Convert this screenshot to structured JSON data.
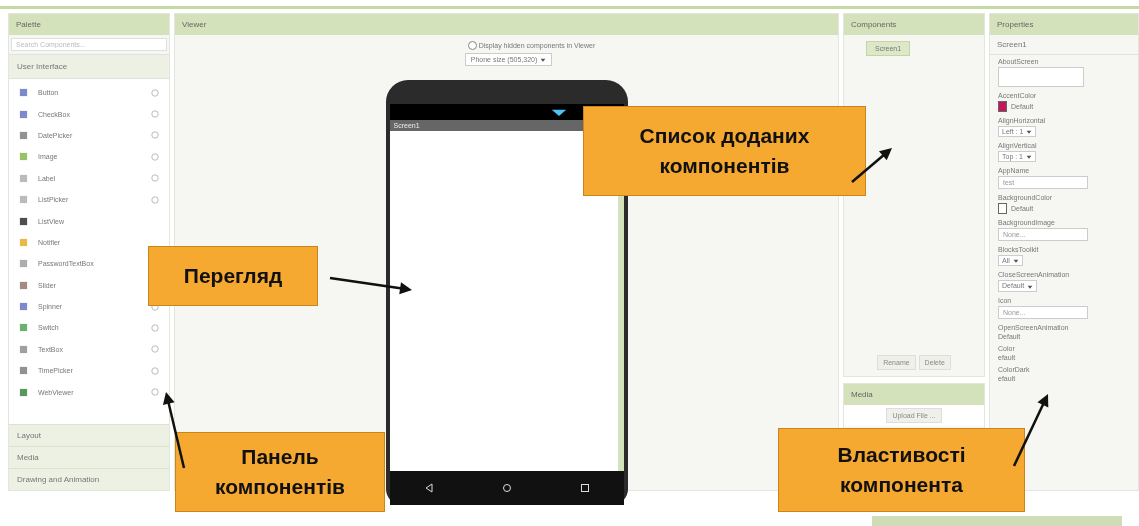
{
  "palette": {
    "title": "Palette",
    "search": {
      "placeholder": "Search Components..."
    },
    "category": "User Interface",
    "items": [
      {
        "label": "Button",
        "help": true
      },
      {
        "label": "CheckBox",
        "help": true
      },
      {
        "label": "DatePicker",
        "help": true
      },
      {
        "label": "Image",
        "help": true
      },
      {
        "label": "Label",
        "help": true
      },
      {
        "label": "ListPicker",
        "help": true
      },
      {
        "label": "ListView",
        "help": false
      },
      {
        "label": "Notifier",
        "help": false
      },
      {
        "label": "PasswordTextBox",
        "help": false
      },
      {
        "label": "Slider",
        "help": false
      },
      {
        "label": "Spinner",
        "help": true
      },
      {
        "label": "Switch",
        "help": true
      },
      {
        "label": "TextBox",
        "help": true
      },
      {
        "label": "TimePicker",
        "help": true
      },
      {
        "label": "WebViewer",
        "help": true
      }
    ],
    "sections": [
      "Layout",
      "Media",
      "Drawing and Animation"
    ]
  },
  "viewer": {
    "title": "Viewer",
    "hidden_toggle": {
      "label": "Display hidden components in Viewer",
      "checked": false
    },
    "size_select": "Phone size (505,320)",
    "phone": {
      "screen_title": "Screen1"
    }
  },
  "components": {
    "title": "Components",
    "tree": [
      {
        "label": "Screen1",
        "selected": true
      }
    ],
    "buttons": [
      "Rename",
      "Delete"
    ]
  },
  "media": {
    "title": "Media",
    "button": "Upload File ..."
  },
  "properties": {
    "title": "Properties",
    "component": "Screen1",
    "items": [
      {
        "kind": "textarea",
        "label": "AboutScreen"
      },
      {
        "kind": "color",
        "label": "AccentColor",
        "value": "Default",
        "color": "#c2185b"
      },
      {
        "kind": "select",
        "label": "AlignHorizontal",
        "value": "Left : 1"
      },
      {
        "kind": "select",
        "label": "AlignVertical",
        "value": "Top : 1"
      },
      {
        "kind": "text",
        "label": "AppName",
        "value": "test"
      },
      {
        "kind": "color",
        "label": "BackgroundColor",
        "value": "Default",
        "color": "#ffffff"
      },
      {
        "kind": "text",
        "label": "BackgroundImage",
        "value": "None..."
      },
      {
        "kind": "select",
        "label": "BlocksToolkit",
        "value": "All"
      },
      {
        "kind": "select",
        "label": "CloseScreenAnimation",
        "value": "Default"
      },
      {
        "kind": "text",
        "label": "Icon",
        "value": "None..."
      },
      {
        "kind": "plain",
        "label": "OpenScreenAnimation",
        "value": "Default"
      },
      {
        "kind": "plain",
        "label": "Color",
        "value": "efault"
      },
      {
        "kind": "plain",
        "label": "ColorDark",
        "value": "efault"
      }
    ]
  },
  "callouts": [
    {
      "text": "Перегляд"
    },
    {
      "text": "Список доданих компонентів"
    },
    {
      "text": "Панель компонентів"
    },
    {
      "text": "Властивості компонента"
    }
  ]
}
